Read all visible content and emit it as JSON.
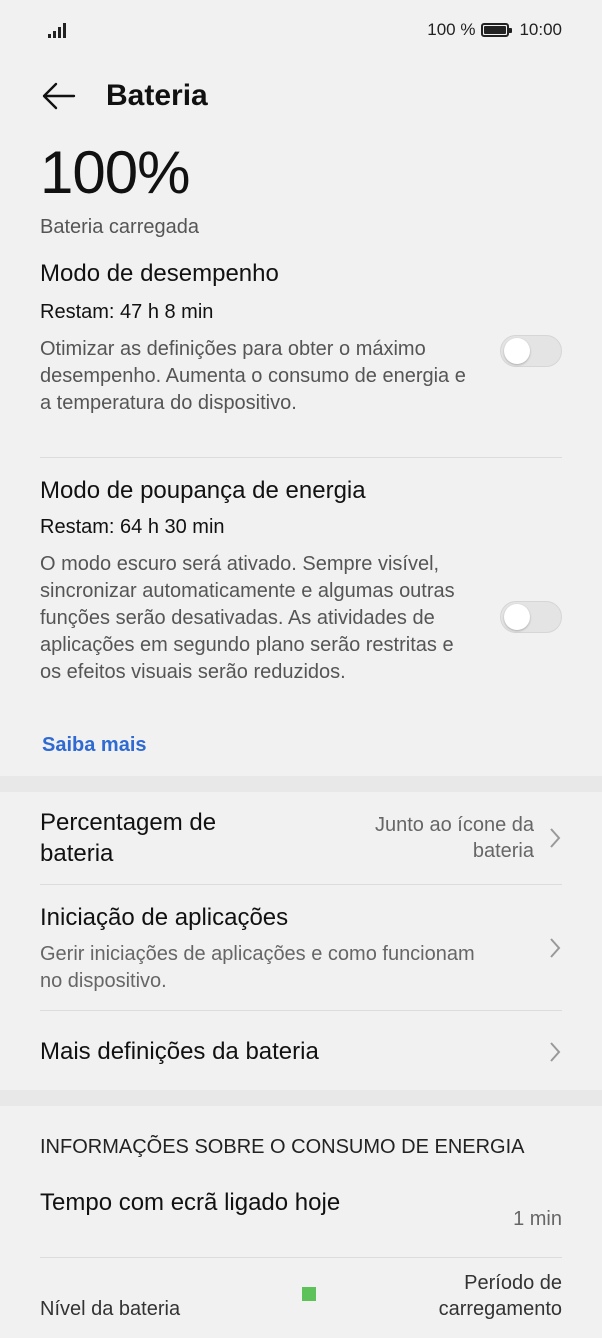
{
  "status_bar": {
    "battery_percent": "100 %",
    "time": "10:00"
  },
  "header": {
    "title": "Bateria"
  },
  "battery": {
    "percent": "100%",
    "state": "Bateria carregada"
  },
  "performance_mode": {
    "title": "Modo de desempenho",
    "remaining": "Restam: 47 h 8 min",
    "description": "Otimizar as definições para obter o máximo desempenho. Aumenta o consumo de energia e a temperatura do dispositivo.",
    "enabled": false
  },
  "power_saving_mode": {
    "title": "Modo de poupança de energia",
    "remaining": "Restam: 64 h 30 min",
    "description": "O modo escuro será ativado. Sempre visível, sincronizar automaticamente e algumas outras funções serão desativadas. As atividades de aplicações em segundo plano serão restritas e os efeitos visuais serão reduzidos.",
    "enabled": false,
    "learn_more": "Saiba mais"
  },
  "settings": {
    "battery_percentage": {
      "title": "Percentagem de bateria",
      "value": "Junto ao ícone da bateria"
    },
    "app_launch": {
      "title": "Iniciação de aplicações",
      "description": "Gerir iniciações de aplicações e como funcionam no dispositivo."
    },
    "more_settings": {
      "title": "Mais definições da bateria"
    }
  },
  "energy_info": {
    "section_title": "INFORMAÇÕES SOBRE O CONSUMO DE ENERGIA",
    "screen_on_time_label": "Tempo com ecrã ligado hoje",
    "screen_on_time_value": "1 min",
    "battery_level_label": "Nível da bateria",
    "charging_period_label": "Período de carregamento",
    "charging_color": "#5ec25a"
  },
  "colors": {
    "accent": "#2e6ad1"
  }
}
